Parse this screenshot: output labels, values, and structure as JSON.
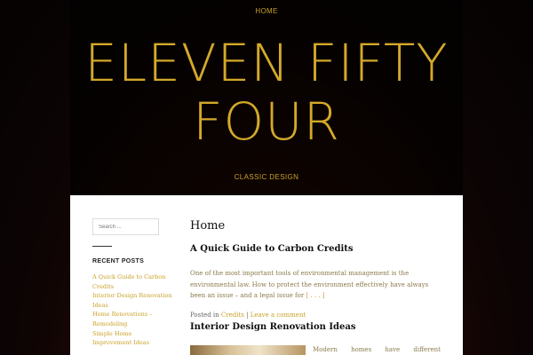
{
  "nav": {
    "home": "HOME"
  },
  "site": {
    "title": "ELEVEN FIFTY FOUR",
    "tagline": "CLASSIC DESIGN"
  },
  "sidebar": {
    "search_placeholder": "Search ...",
    "recent_posts_title": "RECENT POSTS",
    "recent_posts": [
      "A Quick Guide to Carbon Credits",
      "Interior Design Renovation Ideas",
      "Home Renovations – Remodeling",
      "Simple Home Improvement Ideas"
    ]
  },
  "main": {
    "page_title": "Home",
    "posts": [
      {
        "title": "A Quick Guide to Carbon Credits",
        "excerpt": "One of the most important tools of environmental management is the environmental law. How to protect the environment effectively have always been an issue – and a legal issue for",
        "more": "[ . . . ]",
        "posted_in": "Posted in",
        "category": "Credits",
        "separator": "|",
        "comment_link": "Leave a comment"
      },
      {
        "title": "Interior Design Renovation Ideas",
        "excerpt": "Modern homes have different designs"
      }
    ]
  },
  "colors": {
    "accent": "#c9a227",
    "title_gold": "#d4a92a",
    "content_bg": "#ffffff"
  }
}
